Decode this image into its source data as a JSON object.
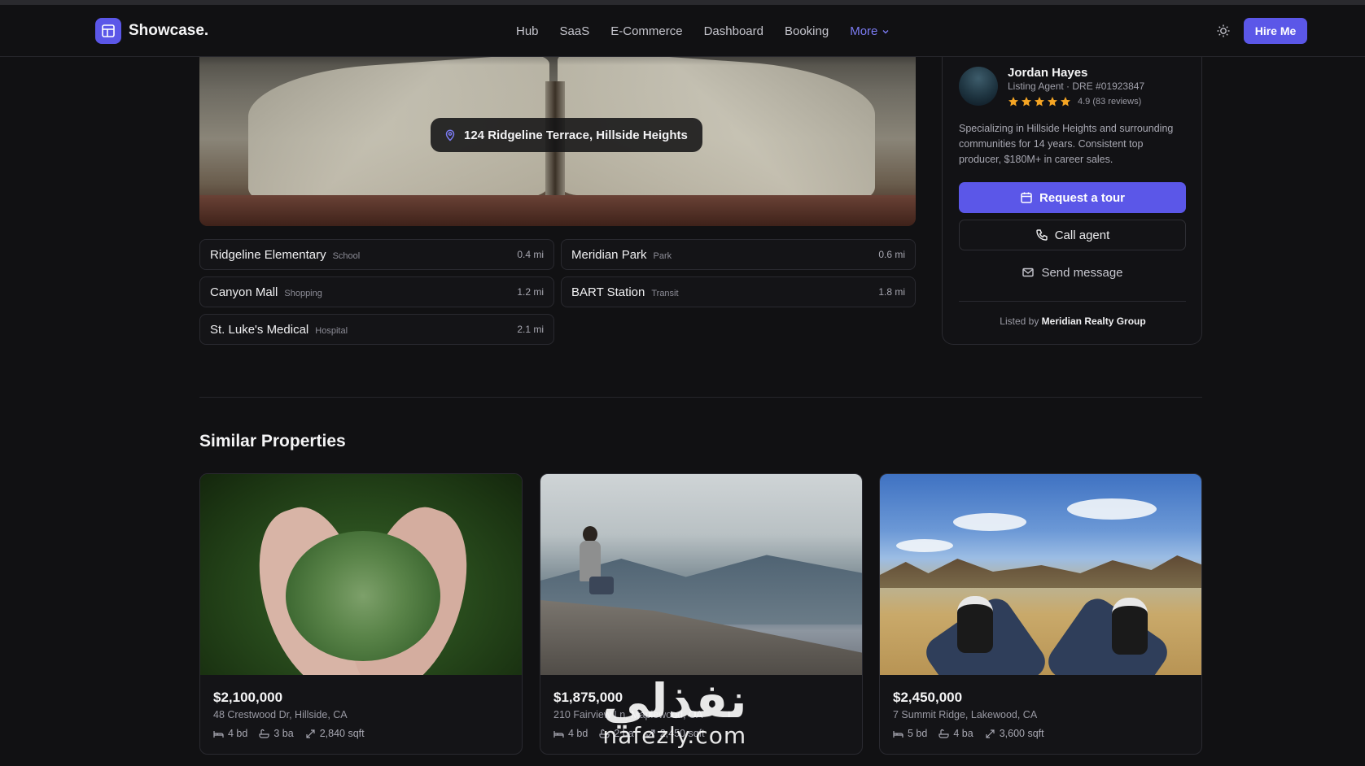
{
  "nav": {
    "brand": "Showcase.",
    "links": [
      "Hub",
      "SaaS",
      "E-Commerce",
      "Dashboard",
      "Booking"
    ],
    "more_label": "More",
    "hire_label": "Hire Me",
    "active_color": "#7b7bf2",
    "accent_color": "#5b57e8"
  },
  "hero": {
    "address": "124 Ridgeline Terrace, Hillside Heights"
  },
  "nearby": [
    {
      "name": "Ridgeline Elementary",
      "category": "School",
      "distance": "0.4 mi"
    },
    {
      "name": "Meridian Park",
      "category": "Park",
      "distance": "0.6 mi"
    },
    {
      "name": "Canyon Mall",
      "category": "Shopping",
      "distance": "1.2 mi"
    },
    {
      "name": "BART Station",
      "category": "Transit",
      "distance": "1.8 mi"
    },
    {
      "name": "St. Luke's Medical",
      "category": "Hospital",
      "distance": "2.1 mi"
    }
  ],
  "agent": {
    "name": "Jordan Hayes",
    "role": "Listing Agent · DRE #01923847",
    "stars": 5,
    "rating": "4.9 (83 reviews)",
    "bio": "Specializing in Hillside Heights and surrounding communities for 14 years. Consistent top producer, $180M+ in career sales.",
    "request_tour_label": "Request a tour",
    "call_label": "Call agent",
    "message_label": "Send message",
    "listed_by_prefix": "Listed by",
    "listed_by_name": "Meridian Realty Group",
    "star_color": "#f5a524"
  },
  "similar": {
    "title": "Similar Properties",
    "cards": [
      {
        "price": "$2,100,000",
        "address": "48 Crestwood Dr, Hillside, CA",
        "beds": "4 bd",
        "baths": "3 ba",
        "sqft": "2,840 sqft"
      },
      {
        "price": "$1,875,000",
        "address": "210 Fairview Ln, Maplewood, CA",
        "beds": "4 bd",
        "baths": "2 ba",
        "sqft": "2,450 sqft"
      },
      {
        "price": "$2,450,000",
        "address": "7 Summit Ridge, Lakewood, CA",
        "beds": "5 bd",
        "baths": "4 ba",
        "sqft": "3,600 sqft"
      }
    ]
  },
  "watermark": {
    "arabic": "نفذلي",
    "latin": "nafezly.com"
  }
}
